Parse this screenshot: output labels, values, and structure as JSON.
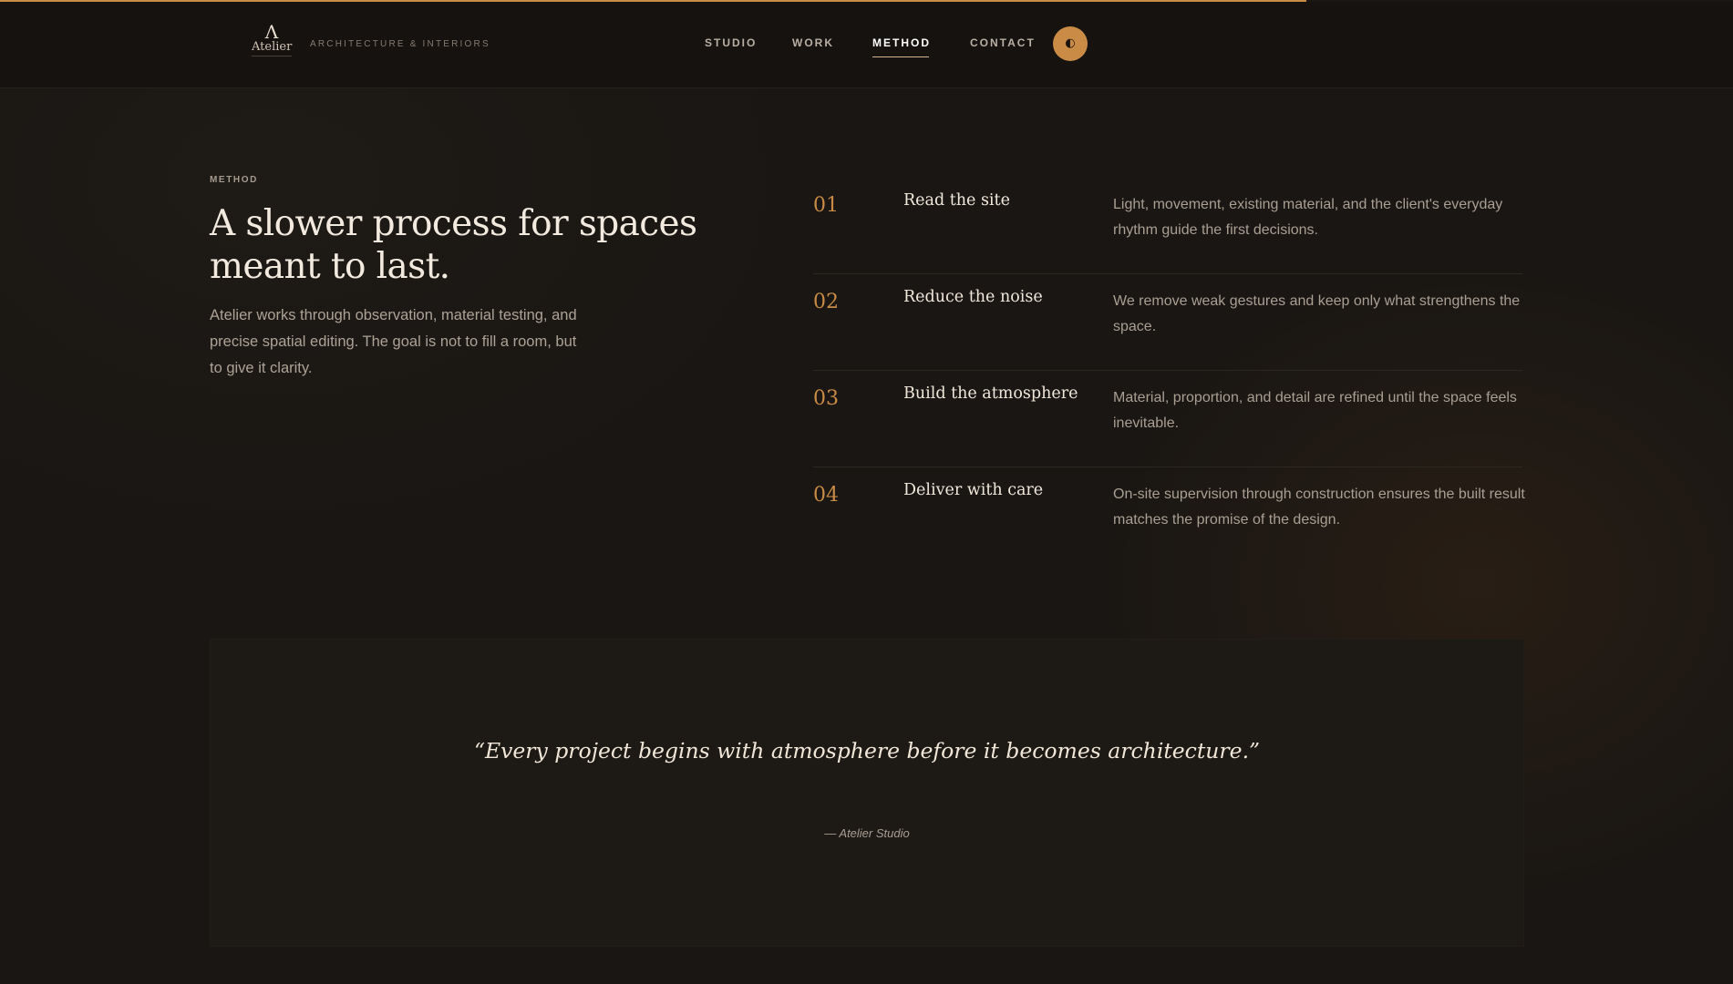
{
  "progress": {
    "fraction": 0.754,
    "color": "#c98b45"
  },
  "brand": {
    "logo_mark": "Λ",
    "logo_word": "Atelier",
    "tagline": "ARCHITECTURE & INTERIORS"
  },
  "nav": {
    "items": [
      {
        "label": "STUDIO",
        "active": false
      },
      {
        "label": "WORK",
        "active": false
      },
      {
        "label": "METHOD",
        "active": true
      },
      {
        "label": "CONTACT",
        "active": false
      }
    ],
    "theme_toggle_icon": "◐"
  },
  "method": {
    "eyebrow": "METHOD",
    "heading": "A slower process for spaces meant to last.",
    "intro": "Atelier works through observation, material testing, and precise spatial editing. The goal is not to fill a room, but to give it clarity.",
    "steps": [
      {
        "number": "01",
        "title": "Read the site",
        "description": "Light, movement, existing material, and the client's everyday rhythm guide the first decisions."
      },
      {
        "number": "02",
        "title": "Reduce the noise",
        "description": "We remove weak gestures and keep only what strengthens the space."
      },
      {
        "number": "03",
        "title": "Build the atmosphere",
        "description": "Material, proportion, and detail are refined until the space feels inevitable."
      },
      {
        "number": "04",
        "title": "Deliver with care",
        "description": "On-site supervision through construction ensures the built result matches the promise of the design."
      }
    ]
  },
  "quote": {
    "text": "“Every project begins with atmosphere before it becomes architecture.”",
    "author": "— Atelier Studio"
  },
  "colors": {
    "accent": "#c98b45",
    "background": "#191613",
    "header": "#151210"
  }
}
